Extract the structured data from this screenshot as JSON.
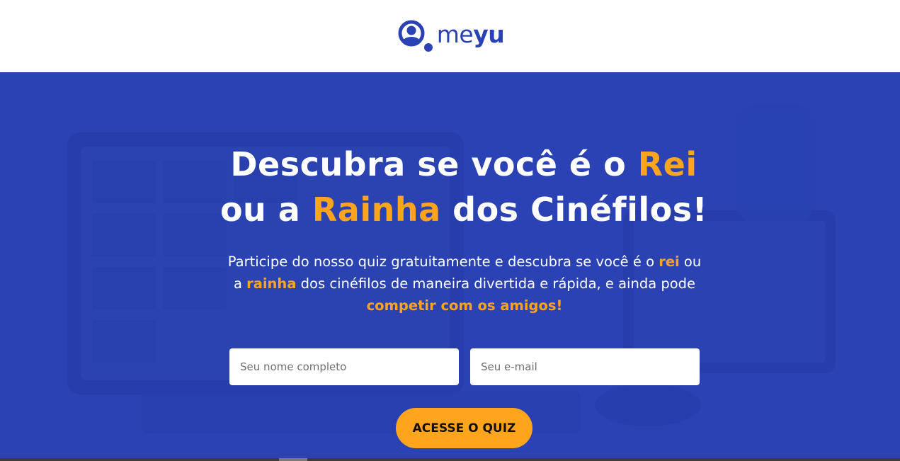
{
  "brand": {
    "logo_light": "me",
    "logo_bold": "yu",
    "logo_color": "#2a42b4"
  },
  "hero": {
    "headline": {
      "part1": "Descubra se você é o ",
      "accent1": "Rei",
      "part2": "ou a ",
      "accent2": "Rainha",
      "part3": " dos Cinéfilos!"
    },
    "subtext": {
      "part1": "Participe do nosso quiz gratuitamente e descubra se você é o ",
      "accent1": "rei",
      "part2": " ou a ",
      "accent2": "rainha",
      "part3": " dos cinéfilos de maneira divertida e rápida, e ainda pode ",
      "accent3": "competir com os amigos!"
    },
    "bg_color": "#2a42b4",
    "accent_color": "#ffa51d"
  },
  "form": {
    "name_placeholder": "Seu nome completo",
    "email_placeholder": "Seu e-mail",
    "submit_label": "ACESSE O QUIZ"
  }
}
